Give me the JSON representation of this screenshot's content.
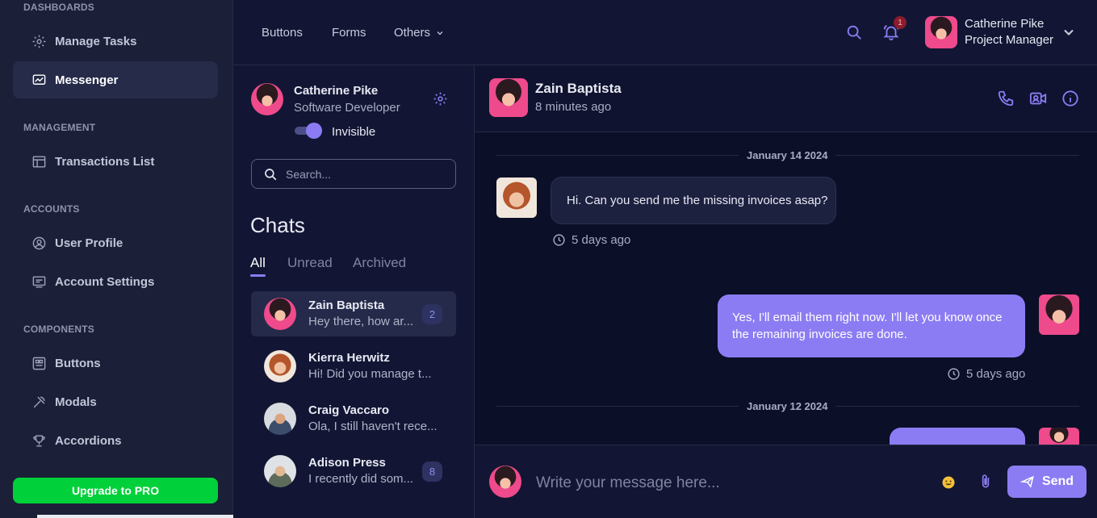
{
  "sidebar": {
    "sections": {
      "dashboards": "DASHBOARDS",
      "management": "MANAGEMENT",
      "accounts": "ACCOUNTS",
      "components": "COMPONENTS"
    },
    "items": {
      "manage_tasks": "Manage Tasks",
      "messenger": "Messenger",
      "transactions": "Transactions List",
      "user_profile": "User Profile",
      "account_settings": "Account Settings",
      "buttons": "Buttons",
      "modals": "Modals",
      "accordions": "Accordions"
    },
    "upgrade": "Upgrade to PRO"
  },
  "topbar": {
    "links": {
      "buttons": "Buttons",
      "forms": "Forms",
      "others": "Others"
    },
    "notification_count": "1",
    "user": {
      "name": "Catherine Pike",
      "role": "Project Manager"
    }
  },
  "chatlist": {
    "me": {
      "name": "Catherine Pike",
      "role": "Software Developer",
      "status": "Invisible"
    },
    "search_placeholder": "Search...",
    "title": "Chats",
    "tabs": {
      "all": "All",
      "unread": "Unread",
      "archived": "Archived"
    },
    "conversations": [
      {
        "name": "Zain Baptista",
        "preview": "Hey there, how ar...",
        "badge": "2"
      },
      {
        "name": "Kierra Herwitz",
        "preview": "Hi! Did you manage t...",
        "badge": ""
      },
      {
        "name": "Craig Vaccaro",
        "preview": "Ola, I still haven't rece...",
        "badge": ""
      },
      {
        "name": "Adison Press",
        "preview": "I recently did som...",
        "badge": "8"
      }
    ]
  },
  "conversation": {
    "contact": {
      "name": "Zain Baptista",
      "last_seen": "8 minutes ago"
    },
    "dates": {
      "first": "January 14 2024",
      "second": "January 12 2024"
    },
    "messages": [
      {
        "text": "Hi. Can you send me the missing invoices asap?",
        "time": "5 days ago"
      },
      {
        "text": "Yes, I'll email them right now. I'll let you know once the remaining invoices are done.",
        "time": "5 days ago"
      }
    ],
    "composer_placeholder": "Write your message here...",
    "send_label": "Send"
  },
  "colors": {
    "accent": "#8c7cf3",
    "upgrade": "#00d03a",
    "sidebar_bg": "#1b1f37",
    "main_bg": "#0b0f28"
  },
  "icons": {
    "sidebar": [
      "gear-icon",
      "messenger-icon",
      "table-icon",
      "user-circle-icon",
      "settings-panel-icon",
      "buttons-icon",
      "modal-icon",
      "trophy-icon"
    ],
    "topbar": [
      "search-icon",
      "bell-icon",
      "chevron-down-icon"
    ],
    "chat_header": [
      "phone-icon",
      "video-icon",
      "info-icon"
    ],
    "composer": [
      "emoji-icon",
      "paperclip-icon",
      "send-icon"
    ]
  }
}
